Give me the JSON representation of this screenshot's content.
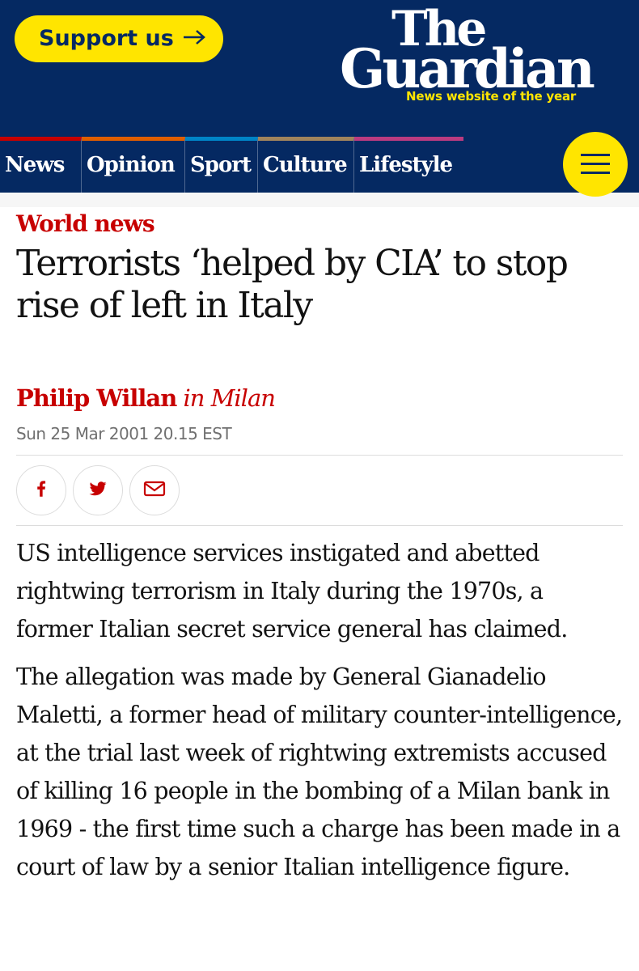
{
  "header": {
    "support_label": "Support us",
    "logo_the": "The",
    "logo_guardian": "Guardian",
    "tagline": "News website of the year"
  },
  "nav": {
    "items": [
      {
        "label": "News",
        "color": "#c70000"
      },
      {
        "label": "Opinion",
        "color": "#e05e00"
      },
      {
        "label": "Sport",
        "color": "#0084c6"
      },
      {
        "label": "Culture",
        "color": "#a1845c"
      },
      {
        "label": "Lifestyle",
        "color": "#bb3b80"
      }
    ]
  },
  "article": {
    "section": "World news",
    "headline": "Terrorists ‘helped by CIA’ to stop rise of left in Italy",
    "author": "Philip Willan",
    "location": "in Milan",
    "date": "Sun 25 Mar 2001 20.15 EST",
    "paragraphs": [
      "US intelligence services instigated and abetted rightwing terrorism in Italy during the 1970s, a former Italian secret service general has claimed.",
      "The allegation was made by General Gianadelio Maletti, a former head of military counter-intelligence, at the trial last week of rightwing extremists accused of killing 16 people in the bombing of a Milan bank in 1969 - the first time such a charge has been made in a court of law by a senior Italian intelligence figure."
    ]
  },
  "share": {
    "icons": [
      "facebook-icon",
      "twitter-icon",
      "email-icon"
    ]
  },
  "colors": {
    "brand_blue": "#052962",
    "support_yellow": "#ffe500",
    "news_red": "#c70000"
  }
}
